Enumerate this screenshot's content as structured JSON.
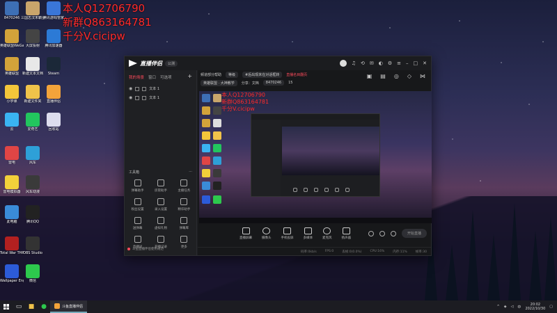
{
  "overlay": {
    "line1": "本人Q12706790",
    "line2": "新群Q863164781",
    "line3": "千分V.cicipw"
  },
  "desktop_icons": [
    {
      "label": "8470246",
      "color": "#3d6fb5"
    },
    {
      "label": "三国志汉末霸业",
      "color": "#c9a56b"
    },
    {
      "label": "腾讯游戏管家",
      "color": "#3a76d8"
    },
    {
      "label": "英雄联盟WeGame版",
      "color": "#d2a33a"
    },
    {
      "label": "大屏投射",
      "color": "#444"
    },
    {
      "label": "腾讯加速器",
      "color": "#2c7ad6"
    },
    {
      "label": "英雄联盟",
      "color": "#d2a33a"
    },
    {
      "label": "新建文本文档",
      "color": "#e8e8e8"
    },
    {
      "label": "Steam",
      "color": "#1b2838"
    },
    {
      "label": "小学课",
      "color": "#f3c53a"
    },
    {
      "label": "新建文件夹",
      "color": "#f0c34a"
    },
    {
      "label": "直播伴侣",
      "color": "#f3a33a"
    },
    {
      "label": "云",
      "color": "#3ab4f2"
    },
    {
      "label": "爱奇艺",
      "color": "#22c55e"
    },
    {
      "label": "回收站",
      "color": "#dde"
    },
    {
      "label": "雷电",
      "color": "#e04545"
    },
    {
      "label": "风车",
      "color": "#2ea0d8"
    },
    {
      "label": "雷电模拟器",
      "color": "#f3d03a"
    },
    {
      "label": "风车动漫",
      "color": "#3a3a3a"
    },
    {
      "label": "此电脑",
      "color": "#3a8bd8"
    },
    {
      "label": "腾讯QQ",
      "color": "#222"
    },
    {
      "label": "Total War THREE KI...",
      "color": "#b32020"
    },
    {
      "label": "OBS Studio",
      "color": "#333"
    },
    {
      "label": "Wallpaper Engine:...",
      "color": "#2c5bd8"
    },
    {
      "label": "微信",
      "color": "#2dc84d"
    }
  ],
  "app": {
    "title": "直播伴侣",
    "beta": "公测",
    "sidebar": {
      "tabs": [
        "我的场景",
        "窗口",
        "可选项"
      ],
      "add": "+",
      "scenes": [
        "文本 1",
        "文本 1"
      ],
      "tools_title": "工具箱",
      "tools_more": "···",
      "tools": [
        "弹幕助手",
        "房管助手",
        "主播任务",
        "粉丝设置",
        "录入设置",
        "精华助手",
        "送弹幕",
        "虚拟礼物",
        "弹幕库",
        "直播间",
        "开播记录",
        "更多"
      ],
      "notice": "斗鱼直播伴侣使用规范"
    },
    "room": {
      "row1": [
        "频道部分帮助",
        "等级",
        "#后出现未在对话框转",
        "直播名目翻页"
      ],
      "row2": [
        "英雄联盟 · 大神教学",
        "分享：文档",
        "8470246",
        "15"
      ]
    },
    "preview_overlay": [
      "本人Q12706790",
      "新群Q863164781",
      "千分V.cicipw"
    ],
    "controls": [
      "直播屏幕",
      "摄像头",
      "手机投屏",
      "多媒体",
      "麦克风",
      "扬声器"
    ],
    "start_label": "开始直播",
    "status": [
      "码率:0kb/s",
      "FPS:0",
      "丢帧:0(0.0%)",
      "CPU:16%",
      "内存:11%",
      "帧率:30"
    ]
  },
  "taskbar": {
    "app_label": "斗鱼直播伴侣",
    "time": "20:02",
    "date": "2022/10/30",
    "lang": "中"
  }
}
